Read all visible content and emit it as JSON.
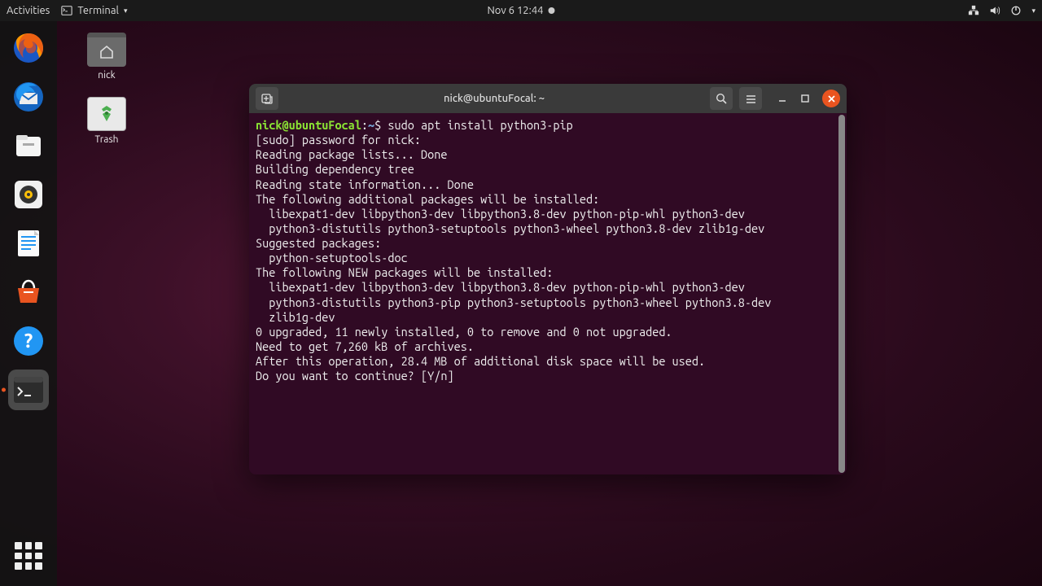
{
  "topbar": {
    "activities": "Activities",
    "app_name": "Terminal",
    "datetime": "Nov 6  12:44"
  },
  "desktop": {
    "home_label": "nick",
    "trash_label": "Trash"
  },
  "terminal": {
    "title": "nick@ubuntuFocal: ~",
    "prompt_user": "nick@ubuntuFocal",
    "prompt_path": "~",
    "prompt_symbol": "$",
    "command": "sudo apt install python3-pip",
    "lines": [
      "[sudo] password for nick:",
      "Reading package lists... Done",
      "Building dependency tree",
      "Reading state information... Done",
      "The following additional packages will be installed:",
      "  libexpat1-dev libpython3-dev libpython3.8-dev python-pip-whl python3-dev",
      "  python3-distutils python3-setuptools python3-wheel python3.8-dev zlib1g-dev",
      "Suggested packages:",
      "  python-setuptools-doc",
      "The following NEW packages will be installed:",
      "  libexpat1-dev libpython3-dev libpython3.8-dev python-pip-whl python3-dev",
      "  python3-distutils python3-pip python3-setuptools python3-wheel python3.8-dev",
      "  zlib1g-dev",
      "0 upgraded, 11 newly installed, 0 to remove and 0 not upgraded.",
      "Need to get 7,260 kB of archives.",
      "After this operation, 28.4 MB of additional disk space will be used.",
      "Do you want to continue? [Y/n]"
    ]
  }
}
